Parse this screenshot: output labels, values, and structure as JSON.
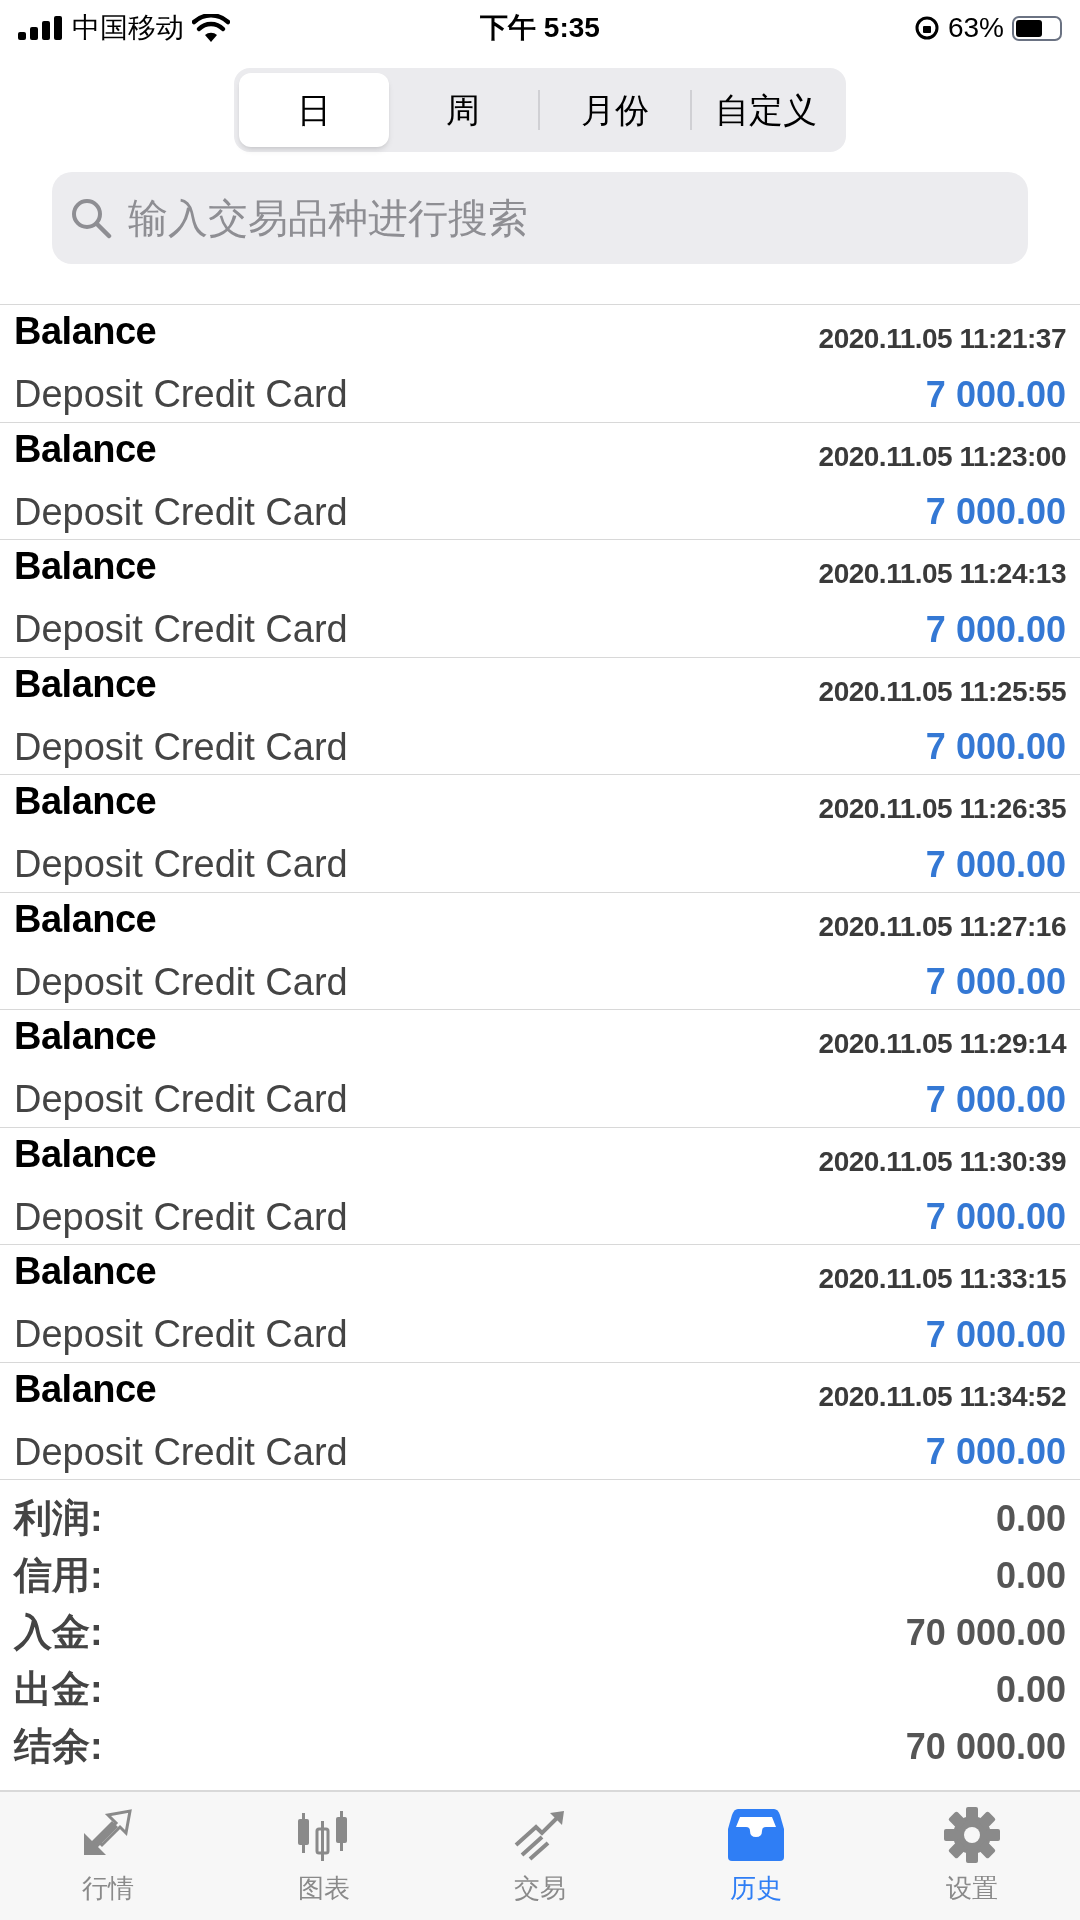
{
  "status_bar": {
    "carrier": "中国移动",
    "time": "下午 5:35",
    "battery": "63%"
  },
  "segments": [
    {
      "label": "日",
      "selected": true
    },
    {
      "label": "周",
      "selected": false
    },
    {
      "label": "月份",
      "selected": false
    },
    {
      "label": "自定义",
      "selected": false
    }
  ],
  "search": {
    "placeholder": "输入交易品种进行搜索"
  },
  "deals": [
    {
      "type": "Balance",
      "comment": "Deposit Credit Card",
      "time": "2020.11.05 11:21:37",
      "amount": "7 000.00"
    },
    {
      "type": "Balance",
      "comment": "Deposit Credit Card",
      "time": "2020.11.05 11:23:00",
      "amount": "7 000.00"
    },
    {
      "type": "Balance",
      "comment": "Deposit Credit Card",
      "time": "2020.11.05 11:24:13",
      "amount": "7 000.00"
    },
    {
      "type": "Balance",
      "comment": "Deposit Credit Card",
      "time": "2020.11.05 11:25:55",
      "amount": "7 000.00"
    },
    {
      "type": "Balance",
      "comment": "Deposit Credit Card",
      "time": "2020.11.05 11:26:35",
      "amount": "7 000.00"
    },
    {
      "type": "Balance",
      "comment": "Deposit Credit Card",
      "time": "2020.11.05 11:27:16",
      "amount": "7 000.00"
    },
    {
      "type": "Balance",
      "comment": "Deposit Credit Card",
      "time": "2020.11.05 11:29:14",
      "amount": "7 000.00"
    },
    {
      "type": "Balance",
      "comment": "Deposit Credit Card",
      "time": "2020.11.05 11:30:39",
      "amount": "7 000.00"
    },
    {
      "type": "Balance",
      "comment": "Deposit Credit Card",
      "time": "2020.11.05 11:33:15",
      "amount": "7 000.00"
    },
    {
      "type": "Balance",
      "comment": "Deposit Credit Card",
      "time": "2020.11.05 11:34:52",
      "amount": "7 000.00"
    }
  ],
  "summary": [
    {
      "label": "利润:",
      "value": "0.00"
    },
    {
      "label": "信用:",
      "value": "0.00"
    },
    {
      "label": "入金:",
      "value": "70 000.00"
    },
    {
      "label": "出金:",
      "value": "0.00"
    },
    {
      "label": "结余:",
      "value": "70 000.00"
    }
  ],
  "tab_bar": [
    {
      "kind": "quotes",
      "label": "行情",
      "selected": false
    },
    {
      "kind": "chart",
      "label": "图表",
      "selected": false
    },
    {
      "kind": "trade",
      "label": "交易",
      "selected": false
    },
    {
      "kind": "history",
      "label": "历史",
      "selected": true
    },
    {
      "kind": "settings",
      "label": "设置",
      "selected": false
    }
  ]
}
